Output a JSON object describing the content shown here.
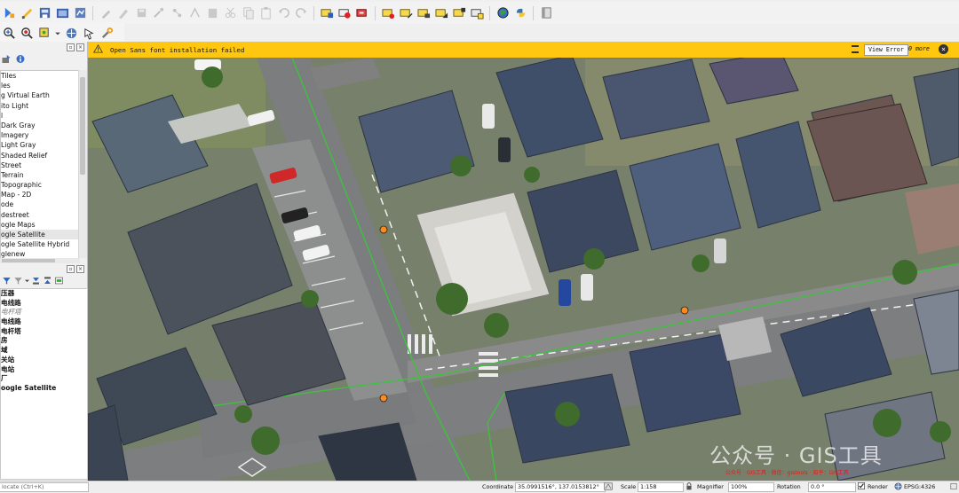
{
  "toolbar_top": {
    "groups": [
      [
        "open-project-icon",
        "new-layer-icon",
        "open-layer-icon",
        "save-project-icon",
        "print-layout-icon"
      ],
      [
        "edit-pencil-icon",
        "toggle-editing-icon",
        "save-edits-icon",
        "digitize-icon",
        "vertex-tool-icon",
        "node-tool-icon",
        "delete-icon",
        "cut-icon",
        "copy-icon",
        "paste-icon",
        "undo-icon",
        "redo-icon"
      ],
      [
        "label-icon",
        "label-pin-icon",
        "label-show-icon",
        "label-move-icon",
        "label-rotate-icon",
        "label-change-icon",
        "label-diagram-icon",
        "label-edit-icon",
        "label-hide-icon"
      ],
      [
        "globe-icon",
        "python-icon"
      ],
      [
        "panel-icon"
      ]
    ]
  },
  "toolbar_second": {
    "items": [
      "zoom-in-icon",
      "zoom-full-icon",
      "zoom-layer-icon",
      "identify-icon",
      "settings-wrench-icon"
    ]
  },
  "browser_panel": {
    "items": [
      "Tiles",
      "les",
      "g Virtual Earth",
      "ito Light",
      "l",
      "Dark Gray",
      "Imagery",
      "Light Gray",
      "Shaded Relief",
      "Street",
      "Terrain",
      "Topographic",
      "Map - 2D",
      "ode",
      "destreet",
      "ogle Maps",
      "ogle Satellite",
      "ogle Satellite Hybrid",
      "glenew"
    ],
    "selected_index": 16
  },
  "layers_panel": {
    "items": [
      "压器",
      "电线路",
      "电杆塔",
      "电线路",
      "电杆塔",
      "房",
      "域",
      "关站",
      "电站",
      "厂",
      "oogle Satellite"
    ],
    "italic_index": 2
  },
  "message_bar": {
    "text": "Open Sans font installation failed",
    "button": "View Error",
    "more": "0 more"
  },
  "watermark": {
    "text": "公众号 · GIS工具",
    "subtext": "公众号 · GIS工具 · 微信：gistools · 知乎：GIS工具"
  },
  "statusbar": {
    "locate": "locate (Ctrl+K)",
    "coordinate_label": "Coordinate",
    "coordinate_value": "35.0991516°, 137.0153812°",
    "scale_label": "Scale",
    "scale_value": "1:158",
    "magnifier_label": "Magnifier",
    "magnifier_value": "100%",
    "rotation_label": "Rotation",
    "rotation_value": "0.0 °",
    "render_label": "Render",
    "crs": "EPSG:4326"
  }
}
